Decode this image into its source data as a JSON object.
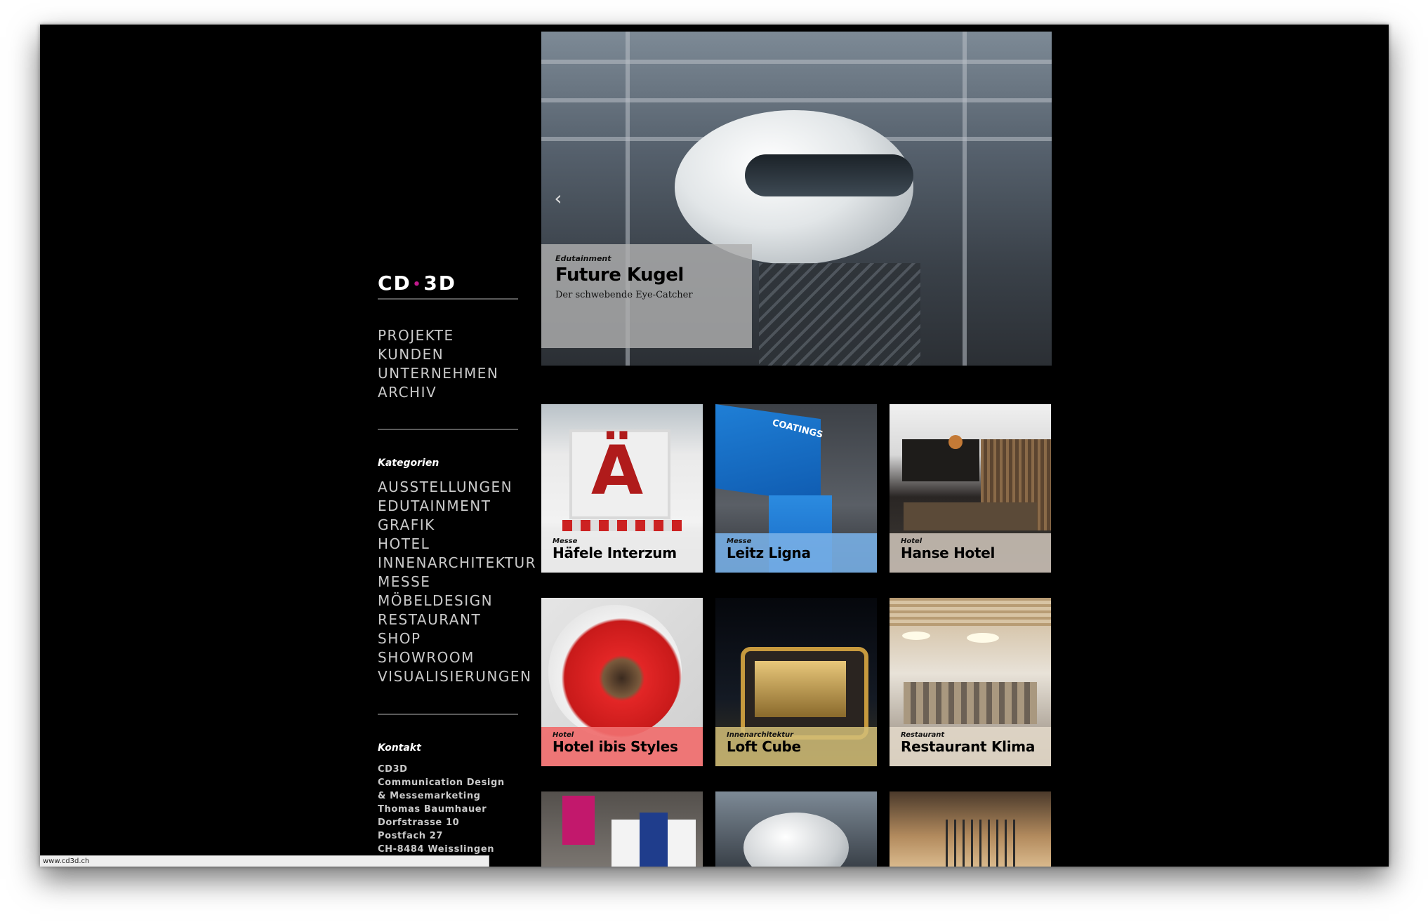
{
  "brand": {
    "logo_left": "CD",
    "logo_dot": "•",
    "logo_right": "3D"
  },
  "nav": [
    "PROJEKTE",
    "KUNDEN",
    "UNTERNEHMEN",
    "ARCHIV"
  ],
  "categories_label": "Kategorien",
  "categories": [
    "AUSSTELLUNGEN",
    "EDUTAINMENT",
    "GRAFIK",
    "HOTEL",
    "INNENARCHITEKTUR",
    "MESSE",
    "MÖBELDESIGN",
    "RESTAURANT",
    "SHOP",
    "SHOWROOM",
    "VISUALISIERUNGEN"
  ],
  "contact_label": "Kontakt",
  "contact_lines": [
    "CD3D",
    "Communication Design",
    "& Messemarketing",
    "Thomas Baumhauer",
    "Dorfstrasse 10",
    "Postfach 27",
    "CH-8484 Weisslingen"
  ],
  "hero": {
    "category": "Edutainment",
    "title": "Future Kugel",
    "subtitle": "Der schwebende Eye-Catcher",
    "prev_icon": "chevron-left-icon"
  },
  "tiles": [
    {
      "category": "Messe",
      "title": "Häfele Interzum",
      "letter": "Ä"
    },
    {
      "category": "Messe",
      "title": "Leitz Ligna",
      "sign": "COATINGS"
    },
    {
      "category": "Hotel",
      "title": "Hanse Hotel"
    },
    {
      "category": "Hotel",
      "title": "Hotel ibis Styles"
    },
    {
      "category": "Innenarchitektur",
      "title": "Loft Cube"
    },
    {
      "category": "Restaurant",
      "title": "Restaurant Klima"
    }
  ],
  "status_url": "www.cd3d.ch",
  "colors": {
    "background": "#000000",
    "accent_dot": "#c21a8c",
    "caption_bg": "#afafaf",
    "nav_text": "#c9c9c9"
  }
}
